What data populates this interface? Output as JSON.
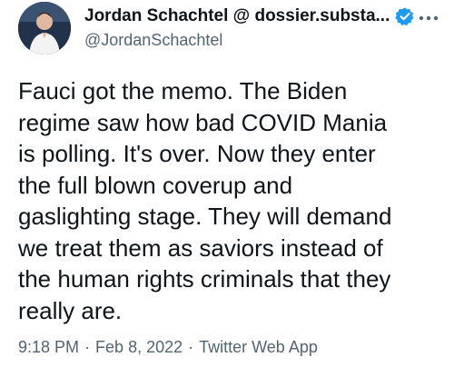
{
  "author": {
    "display_name": "Jordan Schachtel @ dossier.substa...",
    "handle": "@JordanSchachtel",
    "verified": true,
    "avatar_icon": "profile-photo"
  },
  "tweet": {
    "text": "Fauci got the memo. The Biden\nregime saw how bad COVID Mania\nis polling. It's over. Now they enter\nthe full blown coverup and\ngaslighting stage. They will demand\nwe treat them as saviors instead of\nthe human rights criminals that they\nreally are."
  },
  "meta": {
    "time": "9:18 PM",
    "separator": "·",
    "date": "Feb 8, 2022",
    "source": "Twitter Web App"
  },
  "icons": {
    "verified": "verified-badge-icon",
    "more": "more-options-icon"
  },
  "colors": {
    "verified_blue": "#1d9bf0",
    "secondary_text": "#536471",
    "primary_text": "#0f1419"
  }
}
